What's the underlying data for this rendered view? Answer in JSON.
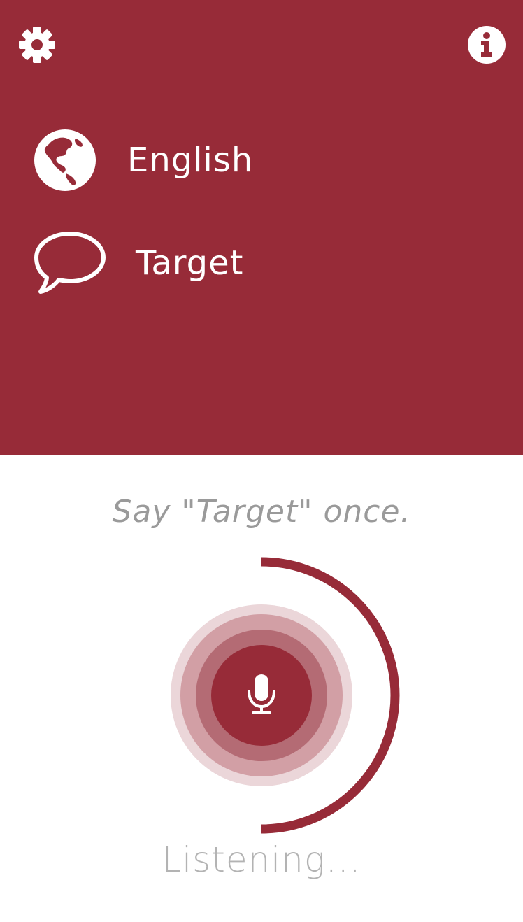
{
  "theme": {
    "accent": "#972b38",
    "ring_outer": "#ebd6d9",
    "ring_middle": "#d29fa5",
    "ring_inner": "#b46b74",
    "background": "#ffffff",
    "prompt_text_color": "#9a9a9a",
    "status_text_color": "#b3b3b3"
  },
  "header": {
    "settings_icon": "gear-icon",
    "info_icon": "info-circle-icon"
  },
  "languages": {
    "source": {
      "icon": "globe-icon",
      "label": "English"
    },
    "target": {
      "icon": "speech-bubble-icon",
      "label": "Target"
    }
  },
  "listening": {
    "prompt": "Say \"Target\" once.",
    "mic_icon": "microphone-icon",
    "progress": 0.5,
    "status": "Listening..."
  }
}
